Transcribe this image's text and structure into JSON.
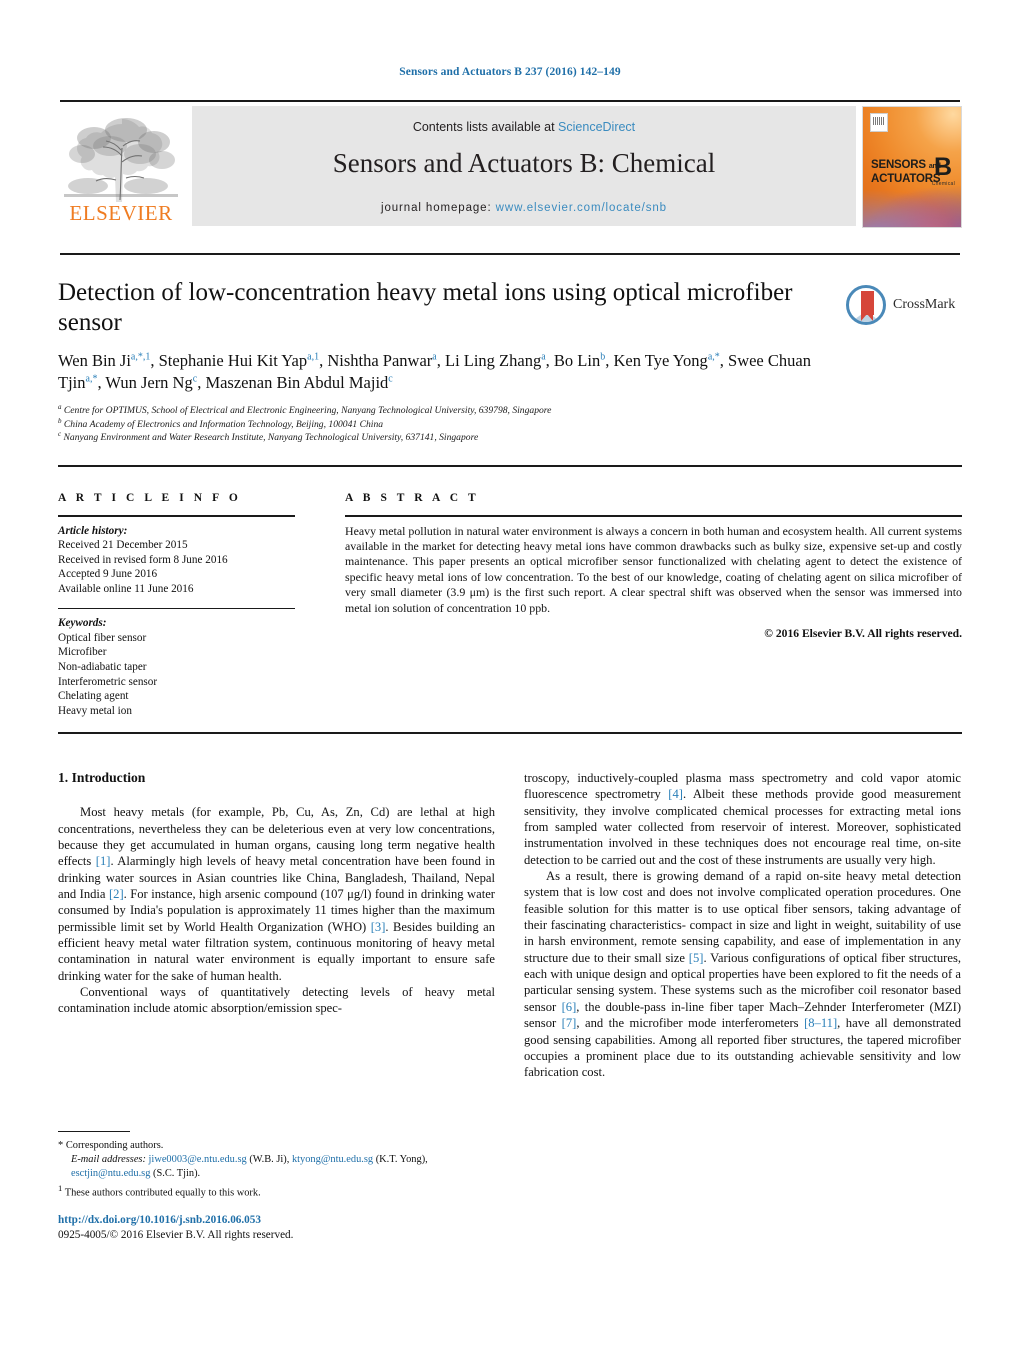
{
  "running_head": "Sensors and Actuators B 237 (2016) 142–149",
  "masthead": {
    "contents_prefix": "Contents lists available at ",
    "sciencedirect": "ScienceDirect",
    "journal_title": "Sensors and Actuators B: Chemical",
    "homepage_prefix": "journal homepage: ",
    "homepage_url": "www.elsevier.com/locate/snb",
    "publisher": "ELSEVIER",
    "publisher_logo_icon": "elsevier-tree-icon",
    "cover": {
      "line1": "SENSORS",
      "line1_suffix": "and",
      "line2": "ACTUATORS",
      "volume_letter": "B",
      "volume_sub": "Chemical"
    }
  },
  "article": {
    "title": "Detection of low-concentration heavy metal ions using optical microfiber sensor",
    "crossmark_label": "CrossMark",
    "crossmark_icon": "crossmark-logo-icon",
    "authors_html": "Wen Bin Ji<sup>a,*,1</sup>, Stephanie Hui Kit Yap<sup>a,1</sup>, Nishtha Panwar<sup>a</sup>, Li Ling Zhang<sup>a</sup>, Bo Lin<sup>b</sup>, Ken Tye Yong<sup>a,*</sup>, Swee Chuan Tjin<sup>a,*</sup>, Wun Jern Ng<sup>c</sup>, Maszenan Bin Abdul Majid<sup>c</sup>",
    "affiliations": [
      "<sup>a</sup> Centre for OPTIMUS, School of Electrical and Electronic Engineering, Nanyang Technological University, 639798, Singapore",
      "<sup>b</sup> China Academy of Electronics and Information Technology, Beijing, 100041 China",
      "<sup>c</sup> Nanyang Environment and Water Research Institute, Nanyang Technological University, 637141, Singapore"
    ]
  },
  "article_info": {
    "heading": "A R T I C L E   I N F O",
    "history_label": "Article history:",
    "history": [
      "Received 21 December 2015",
      "Received in revised form 8 June 2016",
      "Accepted 9 June 2016",
      "Available online 11 June 2016"
    ],
    "keywords_label": "Keywords:",
    "keywords": [
      "Optical fiber sensor",
      "Microfiber",
      "Non-adiabatic taper",
      "Interferometric sensor",
      "Chelating agent",
      "Heavy metal ion"
    ]
  },
  "abstract": {
    "heading": "A B S T R A C T",
    "text": "Heavy metal pollution in natural water environment is always a concern in both human and ecosystem health. All current systems available in the market for detecting heavy metal ions have common drawbacks such as bulky size, expensive set-up and costly maintenance. This paper presents an optical microfiber sensor functionalized with chelating agent to detect the existence of specific heavy metal ions of low concentration. To the best of our knowledge, coating of chelating agent on silica microfiber of very small diameter (3.9 μm) is the first such report. A clear spectral shift was observed when the sensor was immersed into metal ion solution of concentration 10 ppb.",
    "copyright": "© 2016 Elsevier B.V. All rights reserved."
  },
  "body": {
    "section_number_title": "1. Introduction",
    "left_paragraphs_html": [
      "Most heavy metals (for example, Pb, Cu, As, Zn, Cd) are lethal at high concentrations, nevertheless they can be deleterious even at very low concentrations, because they get accumulated in human organs, causing long term negative health effects <span class=\"ref\">[1]</span>. Alarmingly high levels of heavy metal concentration have been found in drinking water sources in Asian countries like China, Bangladesh, Thailand, Nepal and India <span class=\"ref\">[2]</span>. For instance, high arsenic compound (107 μg/l) found in drinking water consumed by India's population is approximately 11 times higher than the maximum permissible limit set by World Health Organization (WHO) <span class=\"ref\">[3]</span>. Besides building an efficient heavy metal water filtration system, continuous monitoring of heavy metal contamination in natural water environment is equally important to ensure safe drinking water for the sake of human health.",
      "Conventional ways of quantitatively detecting levels of heavy metal contamination include atomic absorption/emission spec-"
    ],
    "right_paragraphs_html": [
      "troscopy, inductively-coupled plasma mass spectrometry and cold vapor atomic fluorescence spectrometry <span class=\"ref\">[4]</span>. Albeit these methods provide good measurement sensitivity, they involve complicated chemical processes for extracting metal ions from sampled water collected from reservoir of interest. Moreover, sophisticated instrumentation involved in these techniques does not encourage real time, on-site detection to be carried out and the cost of these instruments are usually very high.",
      "As a result, there is growing demand of a rapid on-site heavy metal detection system that is low cost and does not involve complicated operation procedures. One feasible solution for this matter is to use optical fiber sensors, taking advantage of their fascinating characteristics- compact in size and light in weight, suitability of use in harsh environment, remote sensing capability, and ease of implementation in any structure due to their small size <span class=\"ref\">[5]</span>. Various configurations of optical fiber structures, each with unique design and optical properties have been explored to fit the needs of a particular sensing system. These systems such as the microfiber coil resonator based sensor <span class=\"ref\">[6]</span>, the double-pass in-line fiber taper Mach–Zehnder Interferometer (MZI) sensor <span class=\"ref\">[7]</span>, and the microfiber mode interferometers <span class=\"ref\">[8–11]</span>, have all demonstrated good sensing capabilities. Among all reported fiber structures, the tapered microfiber occupies a prominent place due to its outstanding achievable sensitivity and low fabrication cost."
    ]
  },
  "footnotes": {
    "corresponding_marker": "*",
    "corresponding_text": "Corresponding authors.",
    "email_label": "E-mail addresses:",
    "emails_html": "<span class=\"link\">jiwe0003@e.ntu.edu.sg</span> (W.B. Ji), <span class=\"link\">ktyong@ntu.edu.sg</span> (K.T. Yong), <span class=\"link\">esctjin@ntu.edu.sg</span> (S.C. Tjin).",
    "equal_marker": "1",
    "equal_text": "These authors contributed equally to this work."
  },
  "doi": {
    "url": "http://dx.doi.org/10.1016/j.snb.2016.06.053",
    "issn_line": "0925-4005/© 2016 Elsevier B.V. All rights reserved."
  },
  "colors": {
    "link": "#1f6fa8",
    "reference": "#2a7fb8",
    "elsevier_orange": "#ef7c22",
    "band_bg": "#e6e6e6"
  }
}
